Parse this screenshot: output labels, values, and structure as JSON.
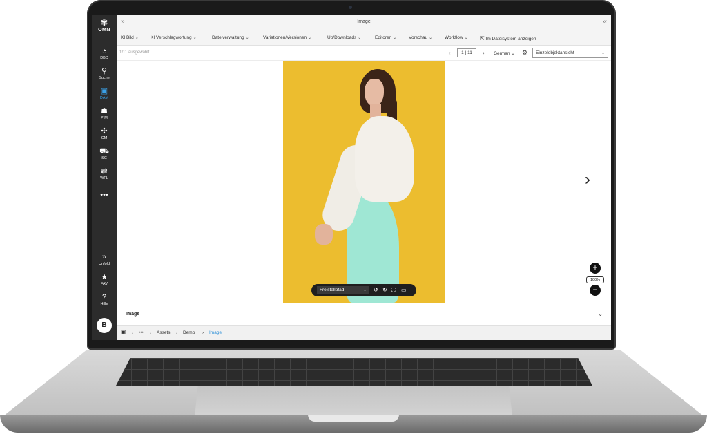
{
  "window": {
    "title": "Image"
  },
  "sidebar": {
    "logo_text": "OMN",
    "items": [
      {
        "label": "DBD",
        "icon": "dashboard-icon"
      },
      {
        "label": "Suche",
        "icon": "search-icon"
      },
      {
        "label": "DAM",
        "icon": "dam-icon",
        "active": true
      },
      {
        "label": "PIM",
        "icon": "pim-icon"
      },
      {
        "label": "CM",
        "icon": "cm-icon"
      },
      {
        "label": "SC",
        "icon": "cart-icon"
      },
      {
        "label": "WFL",
        "icon": "workflow-icon"
      },
      {
        "label": "•••",
        "icon": "more-icon"
      }
    ],
    "bottom_items": [
      {
        "label": "Unfold",
        "icon": "unfold-icon"
      },
      {
        "label": "FAV",
        "icon": "star-icon"
      },
      {
        "label": "Hilfe",
        "icon": "help-icon"
      }
    ],
    "avatar": "B",
    "active_color": "#3aa0e6"
  },
  "menu": {
    "items": [
      "KI Bild",
      "KI Verschlagwortung",
      "Dateiverwaltung",
      "Variationen/Versionen",
      "Up/Downloads",
      "Editoren",
      "Vorschau",
      "Workflow"
    ],
    "filesystem_label": "Im Dateisystem anzeigen"
  },
  "toolbar": {
    "selection": "1/11 ausgewählt",
    "pager": "1 | 11",
    "language": "German",
    "view": "Einzelobjektansicht"
  },
  "viewer": {
    "photo_bg": "#ecbd2f",
    "tool_select": "Freistellpfad",
    "zoom": "100%"
  },
  "panel": {
    "title": "Image"
  },
  "breadcrumb": {
    "items": [
      "•••",
      "Assets",
      "Demo",
      "Image"
    ],
    "active_color": "#2a8fd8"
  }
}
